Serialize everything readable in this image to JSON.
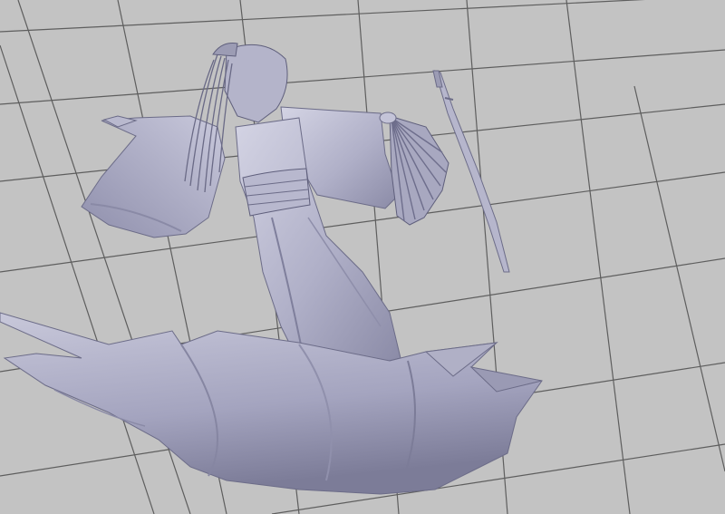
{
  "viewport": {
    "background_color": "#c3c3c3",
    "grid_color": "#5a5a5a",
    "model_color": "#a9a9c2",
    "model_highlight": "#d6d6e6",
    "model_shadow": "#73738f",
    "grid_visible": true
  }
}
